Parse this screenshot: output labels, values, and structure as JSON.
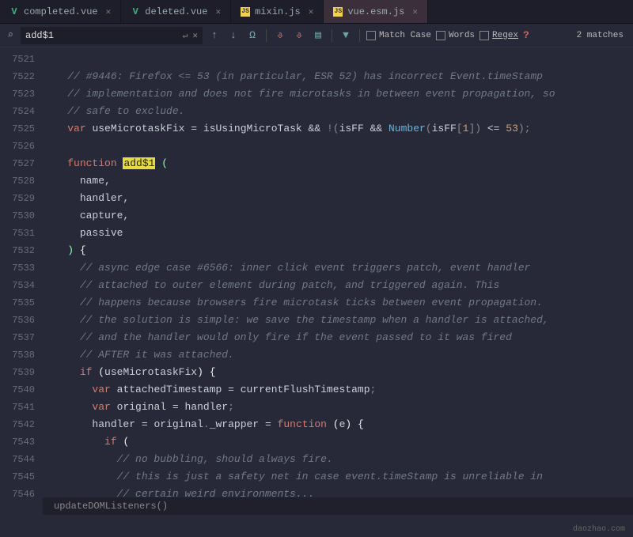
{
  "tabs": [
    {
      "icon": "V",
      "iconClass": "i-vue",
      "label": "completed.vue",
      "active": false
    },
    {
      "icon": "V",
      "iconClass": "i-vue",
      "label": "deleted.vue",
      "active": false
    },
    {
      "icon": "JS",
      "iconClass": "i-js",
      "label": "mixin.js",
      "active": false
    },
    {
      "icon": "JS",
      "iconClass": "i-js",
      "label": "vue.esm.js",
      "active": true
    }
  ],
  "find": {
    "icon": "⌕",
    "value": "add$1",
    "enter": "↵",
    "close": "✕",
    "prev": "↑",
    "next": "↓",
    "all": "Ω",
    "cursor1": "⎀",
    "cursor2": "⎀",
    "book": "▤",
    "filter": "▼",
    "matchcase": "Match Case",
    "words": "Words",
    "regex": "Regex",
    "q": "?",
    "count": "2 matches"
  },
  "first_line": 7521,
  "lines": [
    {
      "t": "e"
    },
    {
      "t": "c",
      "s": "// #9446: Firefox <= 53 (in particular, ESR 52) has incorrect Event.timeStamp"
    },
    {
      "t": "c",
      "s": "// implementation and does not fire microtasks in between event propagation, so"
    },
    {
      "t": "c",
      "s": "// safe to exclude."
    },
    {
      "t": "vardecl",
      "kw": "var",
      "name": "useMicrotaskFix",
      "rhs": [
        {
          "t": "id",
          "s": "isUsingMicroTask"
        },
        {
          "t": "op",
          "s": " && "
        },
        {
          "t": "pn",
          "s": "!("
        },
        {
          "t": "id",
          "s": "isFF"
        },
        {
          "t": "op",
          "s": " && "
        },
        {
          "t": "fn",
          "s": "Number"
        },
        {
          "t": "pn",
          "s": "("
        },
        {
          "t": "id",
          "s": "isFF"
        },
        {
          "t": "pn",
          "s": "["
        },
        {
          "t": "num",
          "s": "1"
        },
        {
          "t": "pn",
          "s": "])"
        },
        {
          "t": "op",
          "s": " <= "
        },
        {
          "t": "num",
          "s": "53"
        },
        {
          "t": "pn",
          "s": ");"
        }
      ]
    },
    {
      "t": "e"
    },
    {
      "t": "fndecl",
      "kw": "function",
      "name": "add$1",
      "paren": " ("
    },
    {
      "t": "param",
      "s": "name,"
    },
    {
      "t": "param",
      "s": "handler,"
    },
    {
      "t": "param",
      "s": "capture,"
    },
    {
      "t": "param",
      "s": "passive"
    },
    {
      "t": "closeparams",
      "s": ") {"
    },
    {
      "t": "c2",
      "s": "// async edge case #6566: inner click event triggers patch, event handler"
    },
    {
      "t": "c2",
      "s": "// attached to outer element during patch, and triggered again. This"
    },
    {
      "t": "c2",
      "s": "// happens because browsers fire microtask ticks between event propagation."
    },
    {
      "t": "c2",
      "s": "// the solution is simple: we save the timestamp when a handler is attached,"
    },
    {
      "t": "c2",
      "s": "// and the handler would only fire if the event passed to it was fired"
    },
    {
      "t": "c2",
      "s": "// AFTER it was attached."
    },
    {
      "t": "if",
      "kw": "if",
      "cond": "useMicrotaskFix"
    },
    {
      "t": "var2",
      "kw": "var",
      "name": "attachedTimestamp",
      "rhs": "currentFlushTimestamp"
    },
    {
      "t": "var2",
      "kw": "var",
      "name": "original",
      "rhs": "handler"
    },
    {
      "t": "assign",
      "lhs": "handler",
      "mid": "original",
      "prop": "_wrapper",
      "kw": "function",
      "arg": "e"
    },
    {
      "t": "ifopen",
      "kw": "if",
      "p": "("
    },
    {
      "t": "c3",
      "s": "// no bubbling, should always fire."
    },
    {
      "t": "c3",
      "s": "// this is just a safety net in case event.timeStamp is unreliable in"
    },
    {
      "t": "c3",
      "s": "// certain weird environments..."
    }
  ],
  "breadcrumb": "updateDOMListeners()",
  "watermark": "daozhao.com"
}
